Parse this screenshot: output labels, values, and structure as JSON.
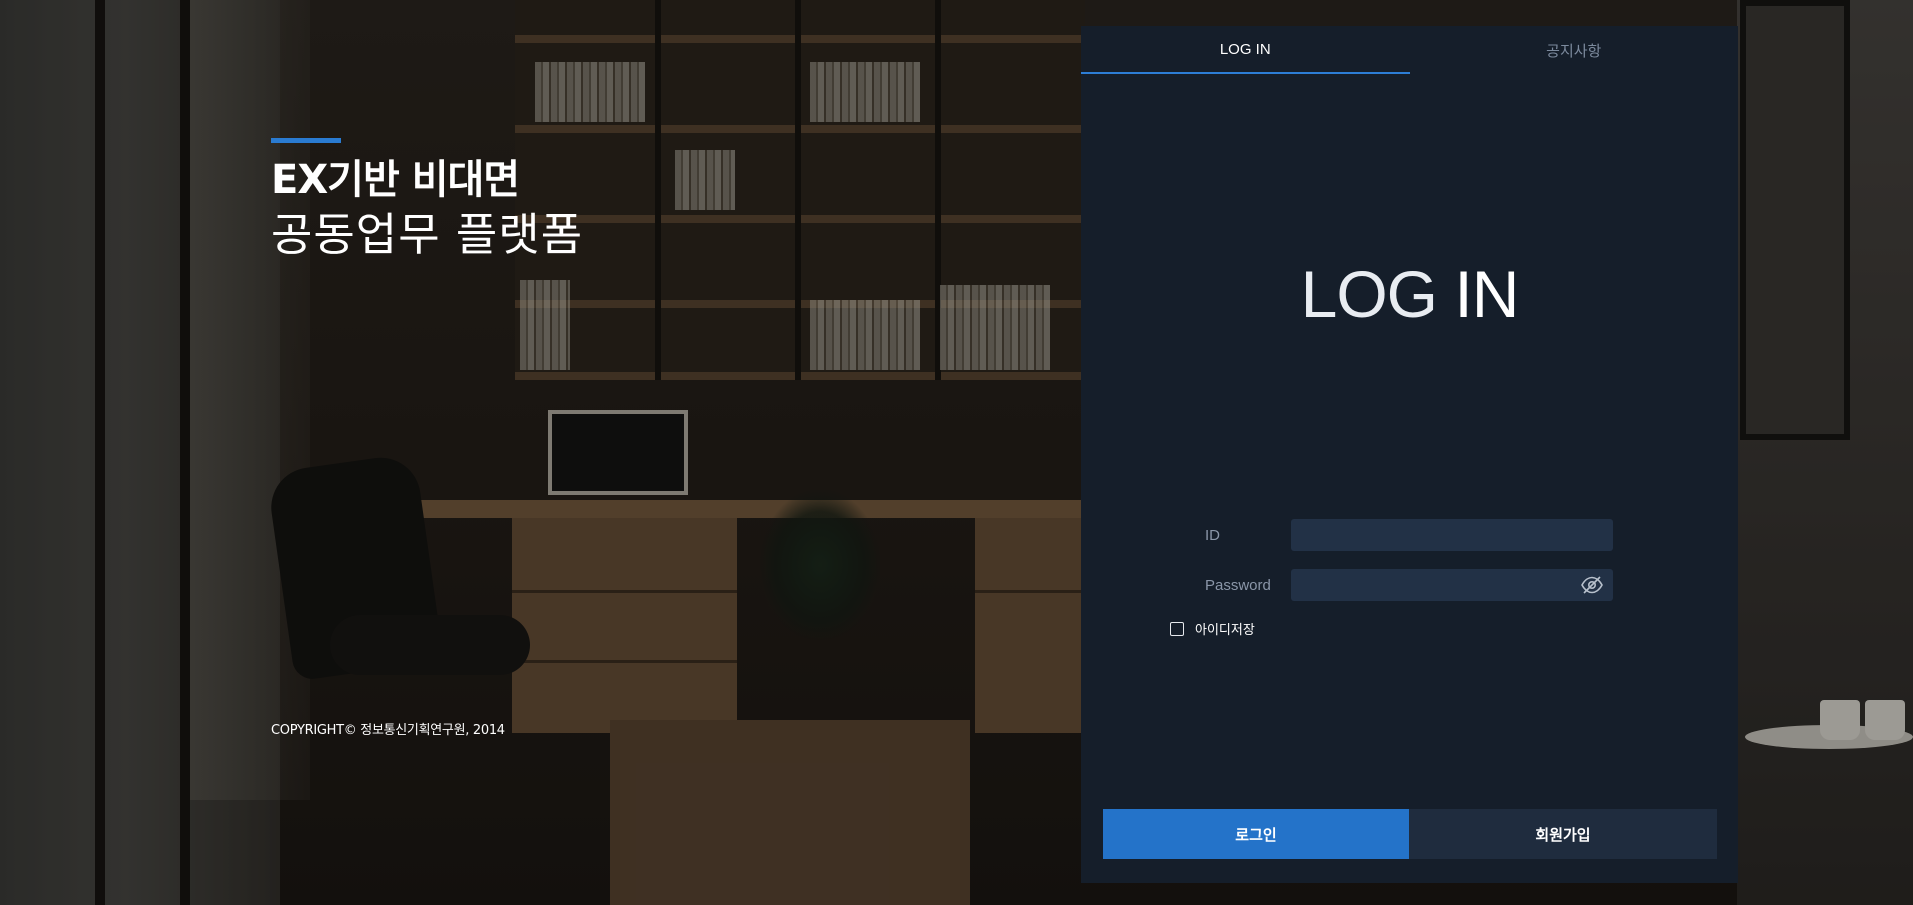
{
  "headline": {
    "line1": "EX기반 비대면",
    "line2": "공동업무 플랫폼"
  },
  "copyright": "COPYRIGHT© 정보통신기획연구원, 2014",
  "panel": {
    "tabs": [
      {
        "label": "LOG IN",
        "active": true
      },
      {
        "label": "공지사항",
        "active": false
      }
    ],
    "title_light": "LOG",
    "title_bold": "IN",
    "id_label": "ID",
    "id_value": "",
    "password_label": "Password",
    "password_value": "",
    "save_id_label": "아이디저장",
    "save_id_checked": false,
    "login_button": "로그인",
    "signup_button": "회원가입"
  },
  "colors": {
    "accent": "#2473c9",
    "panel_bg": "#151e2a",
    "input_bg": "#223146",
    "secondary_button": "#1f2c3e"
  },
  "icons": {
    "password_toggle": "eye-off-icon"
  }
}
